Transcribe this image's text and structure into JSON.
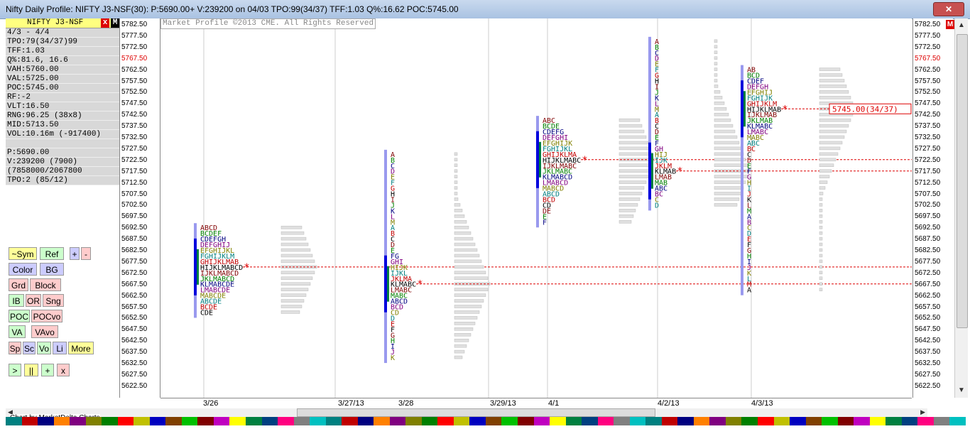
{
  "window": {
    "title": "Nifty Daily Profile: NIFTY J3-NSF(30): P:5690.00+ V:239200 on 04/03 TPO:99(34/37) TFF:1.03 Q%:16.62 POC:5745.00",
    "close_label": "✕"
  },
  "panel": {
    "symbol": "NIFTY J3-NSF",
    "close_label": "x",
    "mode_label": "M",
    "stats": [
      "4/3 - 4/4",
      "TPO:79(34/37)99",
      "TFF:1.03",
      "Q%:81.6, 16.6",
      "VAH:5760.00",
      "VAL:5725.00",
      "POC:5745.00",
      "RF:-2",
      "VLT:16.50",
      "RNG:96.25 (38x8)",
      "MID:5713.50",
      "VOL:10.16m (-917400)",
      "",
      "P:5690.00",
      "V:239200 (7900)",
      "(7858000/2067800",
      "TPO:2 (85/12)"
    ]
  },
  "buttons": [
    {
      "label": "~Sym",
      "bg": "#ffff99"
    },
    {
      "label": "Ref",
      "bg": "#ccffcc"
    },
    {
      "label": "+",
      "bg": "#ccccff"
    },
    {
      "label": "-",
      "bg": "#ffcccc"
    },
    {
      "label": "Color",
      "bg": "#ccccff"
    },
    {
      "label": "BG",
      "bg": "#ccccff"
    },
    {
      "label": "Grd",
      "bg": "#ffcccc"
    },
    {
      "label": "Block",
      "bg": "#ffcccc"
    },
    {
      "label": "IB",
      "bg": "#ccffcc"
    },
    {
      "label": "OR",
      "bg": "#ffcccc"
    },
    {
      "label": "Sng",
      "bg": "#ffcccc"
    },
    {
      "label": "POC",
      "bg": "#ccffcc"
    },
    {
      "label": "POCvo",
      "bg": "#ffcccc"
    },
    {
      "label": "VA",
      "bg": "#ccffcc"
    },
    {
      "label": "VAvo",
      "bg": "#ffcccc"
    },
    {
      "label": "Sp",
      "bg": "#ffcccc"
    },
    {
      "label": "Sc",
      "bg": "#ccccff"
    },
    {
      "label": "Vo",
      "bg": "#ccffcc"
    },
    {
      "label": "Li",
      "bg": "#ccccff"
    },
    {
      "label": "More",
      "bg": "#ffff99"
    },
    {
      "label": ">",
      "bg": "#ccffcc"
    },
    {
      "label": "||",
      "bg": "#ffff99"
    },
    {
      "label": "+",
      "bg": "#ccffcc"
    },
    {
      "label": "x",
      "bg": "#ffcccc"
    }
  ],
  "chart": {
    "copyright": "Market Profile ©2013 CME. All Rights Reserved",
    "price_labels": [
      "5782.50",
      "5777.50",
      "5772.50",
      "5767.50",
      "5762.50",
      "5757.50",
      "5752.50",
      "5747.50",
      "5742.50",
      "5737.50",
      "5732.50",
      "5727.50",
      "5722.50",
      "5717.50",
      "5712.50",
      "5707.50",
      "5702.50",
      "5697.50",
      "5692.50",
      "5687.50",
      "5682.50",
      "5677.50",
      "5672.50",
      "5667.50",
      "5662.50",
      "5657.50",
      "5652.50",
      "5647.50",
      "5642.50",
      "5637.50",
      "5632.50",
      "5627.50",
      "5622.50"
    ],
    "highlight_price": "5767.50",
    "poc_label": "5745.00(34/37)",
    "dates": [
      "3/26",
      "3/27/13",
      "3/28",
      "3/29/13",
      "4/1",
      "4/2/13",
      "4/3/13"
    ],
    "footer": "Chart by MarketDelta Charts"
  },
  "chart_data": {
    "type": "table",
    "profiles": [
      {
        "date": "3/26",
        "poc": 5675.0,
        "high": 5692.5,
        "low": 5655.0
      },
      {
        "date": "3/28",
        "poc": 5667.5,
        "high": 5725.0,
        "low": 5635.0
      },
      {
        "date": "4/1",
        "poc": 5722.5,
        "high": 5740.0,
        "low": 5695.0
      },
      {
        "date": "4/2/13",
        "poc": 5717.5,
        "high": 5775.0,
        "low": 5702.5
      },
      {
        "date": "4/3/13",
        "poc": 5745.0,
        "high": 5762.5,
        "low": 5665.0
      }
    ]
  },
  "colors": {
    "strip": [
      "#008080",
      "#c00000",
      "#000080",
      "#ff8000",
      "#800080",
      "#808000",
      "#008000",
      "#ff0000",
      "#c0c000",
      "#0000c0",
      "#804000",
      "#00c000",
      "#800000",
      "#c000c0",
      "#ffff00",
      "#008040",
      "#004080",
      "#ff0080",
      "#808080",
      "#00c0c0"
    ]
  }
}
